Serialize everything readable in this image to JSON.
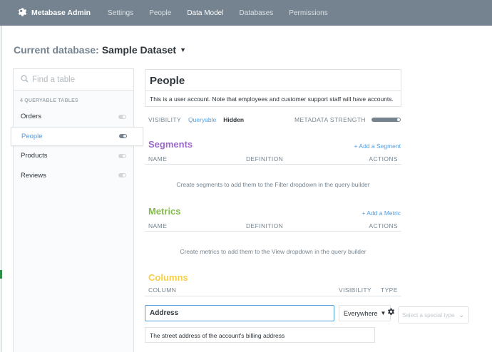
{
  "nav": {
    "brand": "Metabase Admin",
    "links": [
      "Settings",
      "People",
      "Data Model",
      "Databases",
      "Permissions"
    ],
    "active_index": 2
  },
  "database": {
    "label": "Current database:",
    "name": "Sample Dataset"
  },
  "sidebar": {
    "search_placeholder": "Find a table",
    "section_title": "4 Queryable Tables",
    "tables": [
      {
        "name": "Orders",
        "selected": false
      },
      {
        "name": "People",
        "selected": true
      },
      {
        "name": "Products",
        "selected": false
      },
      {
        "name": "Reviews",
        "selected": false
      }
    ]
  },
  "table": {
    "name": "People",
    "description": "This is a user account. Note that employees and customer support staff will have accounts.",
    "visibility_label": "Visibility",
    "visibility_options": [
      "Queryable",
      "Hidden"
    ],
    "metadata_label": "Metadata Strength"
  },
  "segments": {
    "title": "Segments",
    "add_label": "+ Add a Segment",
    "headers": [
      "Name",
      "Definition",
      "Actions"
    ],
    "empty_message": "Create segments to add them to the Filter dropdown in the query builder"
  },
  "metrics": {
    "title": "Metrics",
    "add_label": "+ Add a Metric",
    "headers": [
      "Name",
      "Definition",
      "Actions"
    ],
    "empty_message": "Create metrics to add them to the View dropdown in the query builder"
  },
  "columns": {
    "title": "Columns",
    "headers": [
      "Column",
      "Visibility",
      "Type"
    ],
    "rows": [
      {
        "name": "Address",
        "visibility": "Everywhere",
        "type_placeholder": "Select a special type",
        "description": "The street address of the account's billing address"
      }
    ]
  },
  "colors": {
    "nav_bg": "#74838f",
    "accent_blue": "#509ee3",
    "segments_title": "#9b6ac9",
    "metrics_title": "#84bb4c",
    "columns_title": "#f9cf48",
    "muted_text": "#74838f"
  },
  "icons": {
    "brand": "gear-logo-icon",
    "search": "search-icon",
    "db_caret": "chevron-down-icon",
    "gear": "gear-icon"
  }
}
